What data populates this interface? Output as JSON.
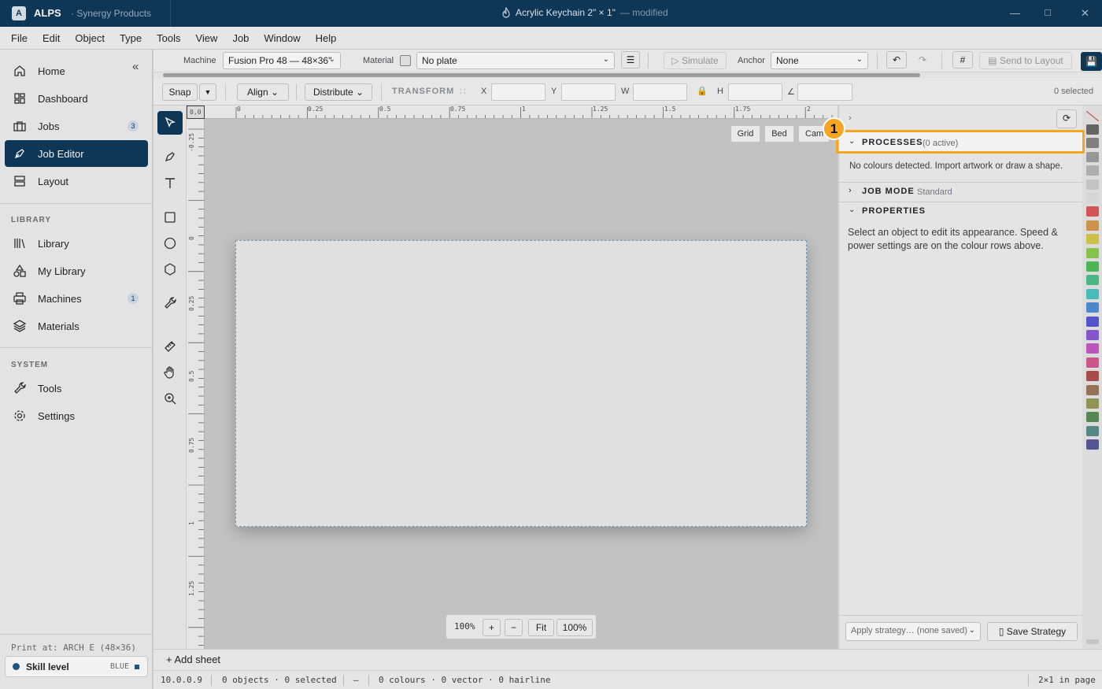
{
  "titlebar": {
    "app_logo": "A",
    "app_name": "ALPS",
    "org": "· Synergy Products",
    "document": "Acrylic Keychain 2\" × 1\"",
    "status": "— modified"
  },
  "menu": [
    "File",
    "Edit",
    "Object",
    "Type",
    "Tools",
    "View",
    "Job",
    "Window",
    "Help"
  ],
  "sidebar": {
    "items": [
      {
        "label": "Home",
        "icon": "home-icon"
      },
      {
        "label": "Dashboard",
        "icon": "dashboard-icon"
      },
      {
        "label": "Jobs",
        "icon": "briefcase-icon",
        "count": "3"
      },
      {
        "label": "Job Editor",
        "icon": "pen-tool-icon",
        "active": true
      },
      {
        "label": "Layout",
        "icon": "layout-icon"
      }
    ],
    "library_heading": "LIBRARY",
    "library_items": [
      {
        "label": "Library",
        "icon": "library-icon"
      },
      {
        "label": "My Library",
        "icon": "shapes-icon"
      },
      {
        "label": "Machines",
        "icon": "printer-icon",
        "count": "1"
      },
      {
        "label": "Materials",
        "icon": "layers-icon"
      }
    ],
    "system_heading": "SYSTEM",
    "system_items": [
      {
        "label": "Tools",
        "icon": "wrench-icon"
      },
      {
        "label": "Settings",
        "icon": "gear-icon"
      }
    ],
    "print_at": "Print at: ARCH E (48×36)",
    "skill_label": "Skill level",
    "skill_value": "BLUE"
  },
  "toolbar": {
    "machine_label": "Machine",
    "machine_value": "Fusion Pro 48 — 48×36\"",
    "material_label": "Material",
    "material_value": "No plate",
    "simulate": "Simulate",
    "anchor_label": "Anchor",
    "anchor_value": "None",
    "send_to_layout": "Send to Layout"
  },
  "transform_bar": {
    "snap": "Snap",
    "align": "Align",
    "distribute": "Distribute",
    "transform": "TRANSFORM",
    "x": "X",
    "y": "Y",
    "w": "W",
    "h": "H",
    "angle": "∠",
    "selected": "0 selected"
  },
  "rulers": {
    "corner": "0,0",
    "h": [
      "0",
      "0.25",
      "0.5",
      "0.75",
      "1",
      "1.25",
      "1.5",
      "1.75",
      "2"
    ],
    "v": [
      "-0.25",
      "0",
      "0.25",
      "0.5",
      "0.75",
      "1",
      "1.25"
    ]
  },
  "canvas": {
    "view_buttons": [
      "Grid",
      "Bed",
      "Cam"
    ],
    "zoom_readout": "100%",
    "zoom_in": "+",
    "zoom_out": "−",
    "fit": "Fit",
    "actual": "100%"
  },
  "panel": {
    "processes_title": "PROCESSES",
    "processes_sub": "(0 active)",
    "processes_empty": "No colours detected. Import artwork or draw a shape.",
    "job_mode_title": "JOB MODE",
    "job_mode_value": "Standard",
    "properties_title": "PROPERTIES",
    "properties_text": "Select an object to edit its appearance. Speed & power settings are on the colour rows above.",
    "strategy_placeholder": "Apply strategy… (none saved)",
    "save_strategy": "Save Strategy"
  },
  "annotation": {
    "badge": "1"
  },
  "swatch_colors": [
    "#6b6b6b",
    "#878787",
    "#a0a0a0",
    "#b8b8b8",
    "#cfcfcf",
    "#e2e2e2",
    "#e05a5a",
    "#d99a4e",
    "#d6cc4a",
    "#8fce4e",
    "#4fbf5a",
    "#4fc08f",
    "#4fc6c6",
    "#4f8fd6",
    "#5a5ad6",
    "#8f5ad6",
    "#c65ac6",
    "#d65a8f",
    "#b05050",
    "#a0785a",
    "#9a9a5a",
    "#5a8f5a",
    "#5a8f8f",
    "#5a5a9a"
  ],
  "add_sheet": "+ Add sheet",
  "statusbar": {
    "version": "10.0.0.9",
    "objects": "0 objects · 0 selected",
    "dash": "—",
    "colours": "0 colours · 0 vector · 0 hairline",
    "fit": "2×1 in page"
  },
  "colors": {
    "brand": "#0f3a5c",
    "accent": "#f5a623"
  }
}
